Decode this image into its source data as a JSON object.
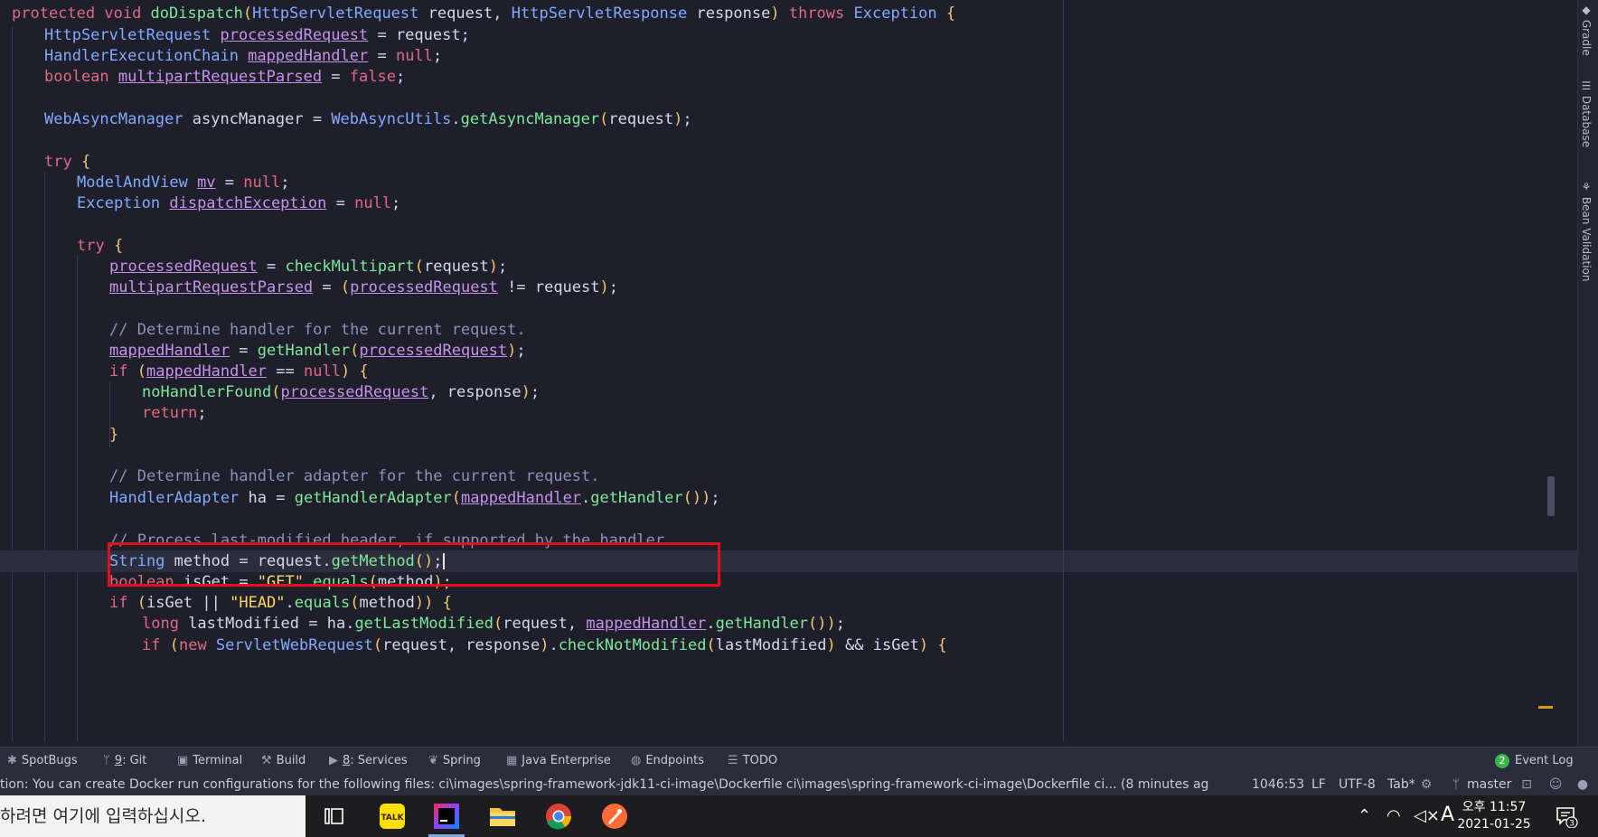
{
  "editor": {
    "lines": [
      {
        "tokens": [
          [
            "kw",
            "protected "
          ],
          [
            "kw",
            "void "
          ],
          [
            "fn",
            "doDispatch"
          ],
          [
            "br",
            "("
          ],
          [
            "ty",
            "HttpServletRequest "
          ],
          [
            "id",
            "request"
          ],
          [
            "p",
            ", "
          ],
          [
            "ty",
            "HttpServletResponse "
          ],
          [
            "id",
            "response"
          ],
          [
            "br",
            ")"
          ],
          [
            "kw",
            " throws "
          ],
          [
            "ty",
            "Exception "
          ],
          [
            "br",
            "{"
          ]
        ]
      },
      {
        "tokens": [
          [
            "ty",
            "HttpServletRequest "
          ],
          [
            "fld",
            "processedRequest"
          ],
          [
            "p",
            " = request;"
          ]
        ]
      },
      {
        "tokens": [
          [
            "ty",
            "HandlerExecutionChain "
          ],
          [
            "fld",
            "mappedHandler"
          ],
          [
            "p",
            " = "
          ],
          [
            "kw",
            "null"
          ],
          [
            "p",
            ";"
          ]
        ]
      },
      {
        "tokens": [
          [
            "kw",
            "boolean "
          ],
          [
            "fld",
            "multipartRequestParsed"
          ],
          [
            "p",
            " = "
          ],
          [
            "kw",
            "false"
          ],
          [
            "p",
            ";"
          ]
        ]
      },
      {
        "tokens": []
      },
      {
        "tokens": [
          [
            "ty",
            "WebAsyncManager "
          ],
          [
            "id",
            "asyncManager"
          ],
          [
            "p",
            " = "
          ],
          [
            "ty",
            "WebAsyncUtils"
          ],
          [
            "p",
            "."
          ],
          [
            "fn",
            "getAsyncManager"
          ],
          [
            "br",
            "("
          ],
          [
            "id",
            "request"
          ],
          [
            "br",
            ")"
          ],
          [
            "p",
            ";"
          ]
        ]
      },
      {
        "tokens": []
      },
      {
        "tokens": [
          [
            "kw",
            "try "
          ],
          [
            "br",
            "{"
          ]
        ]
      },
      {
        "tokens": [
          [
            "ty",
            "ModelAndView "
          ],
          [
            "fld",
            "mv"
          ],
          [
            "p",
            " = "
          ],
          [
            "kw",
            "null"
          ],
          [
            "p",
            ";"
          ]
        ]
      },
      {
        "tokens": [
          [
            "ty",
            "Exception "
          ],
          [
            "fld",
            "dispatchException"
          ],
          [
            "p",
            " = "
          ],
          [
            "kw",
            "null"
          ],
          [
            "p",
            ";"
          ]
        ]
      },
      {
        "tokens": []
      },
      {
        "tokens": [
          [
            "kw",
            "try "
          ],
          [
            "br",
            "{"
          ]
        ]
      },
      {
        "tokens": [
          [
            "fld",
            "processedRequest"
          ],
          [
            "p",
            " = "
          ],
          [
            "fn",
            "checkMultipart"
          ],
          [
            "br",
            "("
          ],
          [
            "id",
            "request"
          ],
          [
            "br",
            ")"
          ],
          [
            "p",
            ";"
          ]
        ]
      },
      {
        "tokens": [
          [
            "fld",
            "multipartRequestParsed"
          ],
          [
            "p",
            " = "
          ],
          [
            "br",
            "("
          ],
          [
            "fld",
            "processedRequest"
          ],
          [
            "p",
            " != request"
          ],
          [
            "br",
            ")"
          ],
          [
            "p",
            ";"
          ]
        ]
      },
      {
        "tokens": []
      },
      {
        "tokens": [
          [
            "cm",
            "// Determine handler for the current request."
          ]
        ]
      },
      {
        "tokens": [
          [
            "fld",
            "mappedHandler"
          ],
          [
            "p",
            " = "
          ],
          [
            "fn",
            "getHandler"
          ],
          [
            "br",
            "("
          ],
          [
            "fld",
            "processedRequest"
          ],
          [
            "br",
            ")"
          ],
          [
            "p",
            ";"
          ]
        ]
      },
      {
        "tokens": [
          [
            "kw",
            "if "
          ],
          [
            "br",
            "("
          ],
          [
            "fld",
            "mappedHandler"
          ],
          [
            "p",
            " == "
          ],
          [
            "kw",
            "null"
          ],
          [
            "br",
            ") {"
          ]
        ]
      },
      {
        "tokens": [
          [
            "fn",
            "noHandlerFound"
          ],
          [
            "br",
            "("
          ],
          [
            "fld",
            "processedRequest"
          ],
          [
            "p",
            ", response"
          ],
          [
            "br",
            ")"
          ],
          [
            "p",
            ";"
          ]
        ]
      },
      {
        "tokens": [
          [
            "kw",
            "return"
          ],
          [
            "p",
            ";"
          ]
        ]
      },
      {
        "tokens": [
          [
            "br",
            "}"
          ]
        ]
      },
      {
        "tokens": []
      },
      {
        "tokens": [
          [
            "cm",
            "// Determine handler adapter for the current request."
          ]
        ]
      },
      {
        "tokens": [
          [
            "ty",
            "HandlerAdapter "
          ],
          [
            "id",
            "ha"
          ],
          [
            "p",
            " = "
          ],
          [
            "fn",
            "getHandlerAdapter"
          ],
          [
            "br",
            "("
          ],
          [
            "fld",
            "mappedHandler"
          ],
          [
            "p",
            "."
          ],
          [
            "fn",
            "getHandler"
          ],
          [
            "br",
            "())"
          ],
          [
            "p",
            ";"
          ]
        ]
      },
      {
        "tokens": []
      },
      {
        "tokens": [
          [
            "cm",
            "// Process last-modified header, if supported by the handler."
          ]
        ]
      },
      {
        "tokens": [
          [
            "ty",
            "String "
          ],
          [
            "id",
            "method"
          ],
          [
            "p",
            " = request."
          ],
          [
            "fn",
            "getMethod"
          ],
          [
            "br",
            "()"
          ],
          [
            "p",
            ";"
          ]
        ]
      },
      {
        "tokens": [
          [
            "kw",
            "boolean "
          ],
          [
            "id",
            "isGet"
          ],
          [
            "p",
            " = "
          ],
          [
            "str",
            "\"GET\""
          ],
          [
            "p",
            "."
          ],
          [
            "fn",
            "equals"
          ],
          [
            "br",
            "("
          ],
          [
            "id",
            "method"
          ],
          [
            "br",
            ")"
          ],
          [
            "p",
            ";"
          ]
        ]
      },
      {
        "tokens": [
          [
            "kw",
            "if "
          ],
          [
            "br",
            "("
          ],
          [
            "id",
            "isGet"
          ],
          [
            "p",
            " || "
          ],
          [
            "str",
            "\"HEAD\""
          ],
          [
            "p",
            "."
          ],
          [
            "fn",
            "equals"
          ],
          [
            "br",
            "("
          ],
          [
            "id",
            "method"
          ],
          [
            "br",
            ")) {"
          ]
        ]
      },
      {
        "tokens": [
          [
            "kw",
            "long "
          ],
          [
            "id",
            "lastModified"
          ],
          [
            "p",
            " = ha."
          ],
          [
            "fn",
            "getLastModified"
          ],
          [
            "br",
            "("
          ],
          [
            "id",
            "request"
          ],
          [
            "p",
            ", "
          ],
          [
            "fld",
            "mappedHandler"
          ],
          [
            "p",
            "."
          ],
          [
            "fn",
            "getHandler"
          ],
          [
            "br",
            "())"
          ],
          [
            "p",
            ";"
          ]
        ]
      },
      {
        "tokens": [
          [
            "kw",
            "if "
          ],
          [
            "br",
            "("
          ],
          [
            "kw",
            "new "
          ],
          [
            "ty",
            "ServletWebRequest"
          ],
          [
            "br",
            "("
          ],
          [
            "id",
            "request"
          ],
          [
            "p",
            ", response"
          ],
          [
            "br",
            ")"
          ],
          [
            "p",
            "."
          ],
          [
            "fn",
            "checkNotModified"
          ],
          [
            "br",
            "("
          ],
          [
            "id",
            "lastModified"
          ],
          [
            "br",
            ")"
          ],
          [
            "p",
            " && isGet"
          ],
          [
            "br",
            ") {"
          ]
        ]
      }
    ]
  },
  "right_tabs": [
    "Gradle",
    "Database",
    "Bean Validation"
  ],
  "tool_windows": [
    {
      "label": "SpotBugs",
      "icon": "bug-icon"
    },
    {
      "num": "9",
      "label": ": Git",
      "icon": "git-branch-icon"
    },
    {
      "label": "Terminal",
      "icon": "terminal-icon"
    },
    {
      "label": "Build",
      "icon": "hammer-icon"
    },
    {
      "num": "8",
      "label": ": Services",
      "icon": "services-icon"
    },
    {
      "label": "Spring",
      "icon": "spring-leaf-icon"
    },
    {
      "label": "Java Enterprise",
      "icon": "java-enterprise-icon"
    },
    {
      "label": "Endpoints",
      "icon": "globe-icon"
    },
    {
      "label": "TODO",
      "icon": "list-icon"
    }
  ],
  "event_log": {
    "label": "Event Log",
    "count": "2"
  },
  "status": {
    "message": "tion: You can create Docker run configurations for the following files: ci\\images\\spring-framework-jdk11-ci-image\\Dockerfile ci\\images\\spring-framework-ci-image\\Dockerfile ci... (8 minutes ag",
    "position": "1046:53",
    "line_sep": "LF",
    "encoding": "UTF-8",
    "indent": "Tab*",
    "branch": "master"
  },
  "taskbar": {
    "search_text": "하려면 여기에 입력하십시오.",
    "kakao_label": "TALK",
    "ime": "A",
    "time": "오후 11:57",
    "date": "2021-01-25",
    "notifications": "3"
  },
  "colors": {
    "highlight_box": "#e0101a",
    "background": "#1e1f2b",
    "accent": "#7aa7e0"
  }
}
